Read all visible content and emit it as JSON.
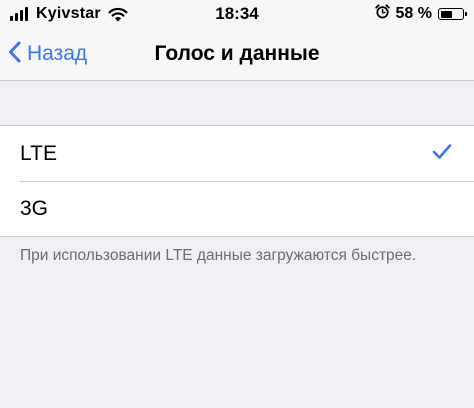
{
  "status_bar": {
    "carrier": "Kyivstar",
    "time": "18:34",
    "battery_percent": "58 %",
    "battery_level": 0.58,
    "icons": [
      "signal-icon",
      "wifi-icon",
      "alarm-icon",
      "battery-icon"
    ]
  },
  "nav": {
    "back_label": "Назад",
    "title": "Голос и данные"
  },
  "options": [
    {
      "label": "LTE",
      "selected": true
    },
    {
      "label": "3G",
      "selected": false
    }
  ],
  "footer": {
    "note": "При использовании LTE данные загружаются быстрее."
  },
  "colors": {
    "accent": "#3478f6",
    "background": "#efeff4",
    "separator": "#c8c7cc",
    "footer_text": "#6d6d72"
  }
}
